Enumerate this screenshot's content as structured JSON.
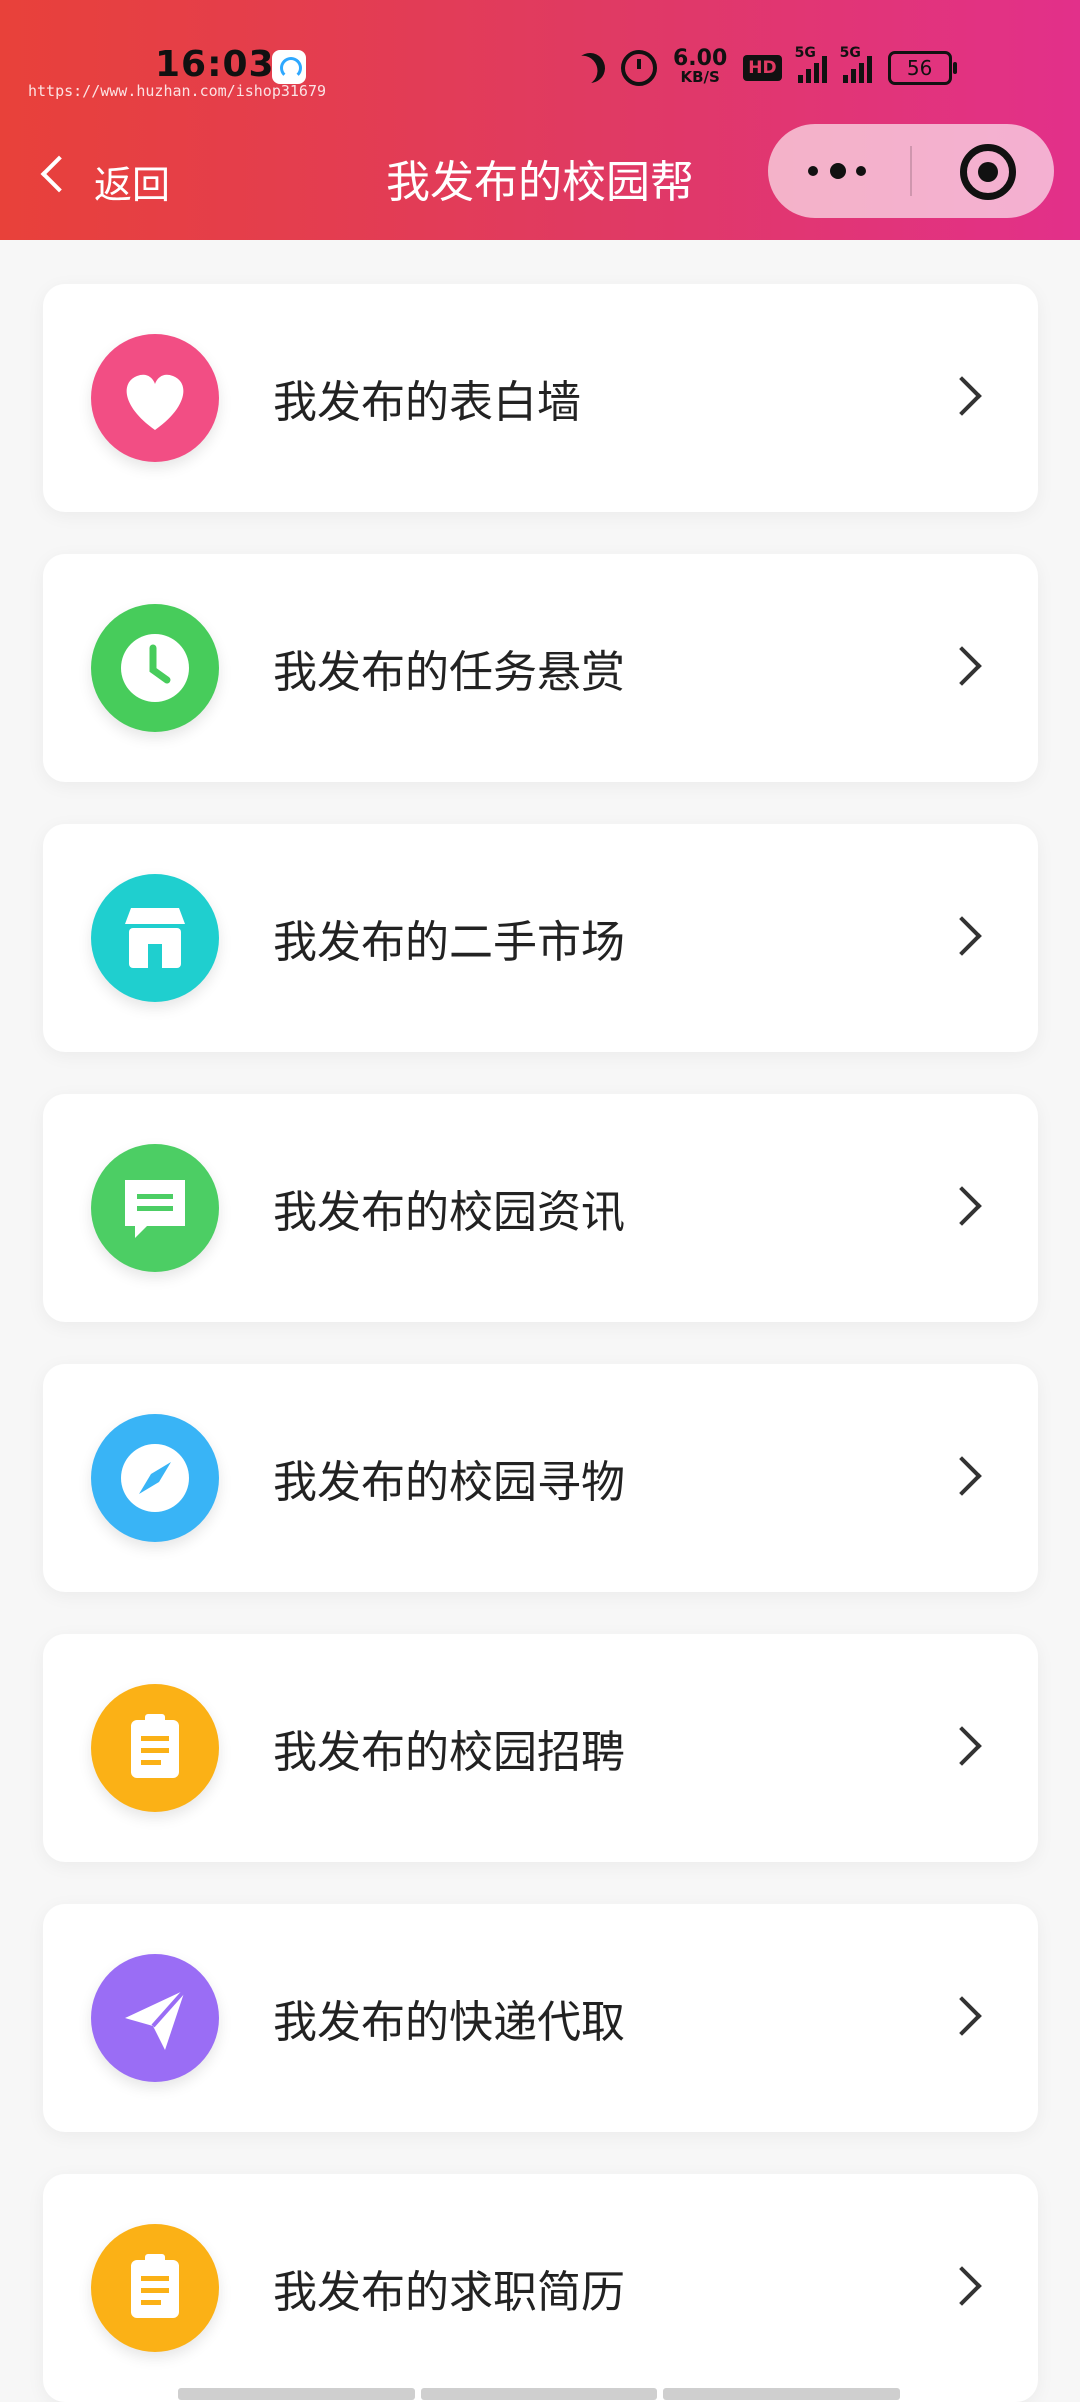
{
  "status_bar": {
    "time": "16:03",
    "watermark": "https://www.huzhan.com/ishop31679",
    "net_speed": "6.00",
    "net_unit": "KB/S",
    "hd_label": "HD",
    "sim1": "5G",
    "sim2": "5G",
    "battery": "56"
  },
  "nav": {
    "back_label": "返回",
    "title": "我发布的校园帮"
  },
  "items": [
    {
      "label": "我发布的表白墙",
      "icon": "heart-icon",
      "color": "#f24e84"
    },
    {
      "label": "我发布的任务悬赏",
      "icon": "clock-icon",
      "color": "#47cc5b"
    },
    {
      "label": "我发布的二手市场",
      "icon": "store-icon",
      "color": "#1fcfcf"
    },
    {
      "label": "我发布的校园资讯",
      "icon": "message-icon",
      "color": "#4cce64"
    },
    {
      "label": "我发布的校园寻物",
      "icon": "compass-icon",
      "color": "#39b4f6"
    },
    {
      "label": "我发布的校园招聘",
      "icon": "clipboard-icon",
      "color": "#fbb116"
    },
    {
      "label": "我发布的快递代取",
      "icon": "paper-plane-icon",
      "color": "#9a6df5"
    },
    {
      "label": "我发布的求职简历",
      "icon": "clipboard-icon",
      "color": "#fbb116"
    }
  ]
}
